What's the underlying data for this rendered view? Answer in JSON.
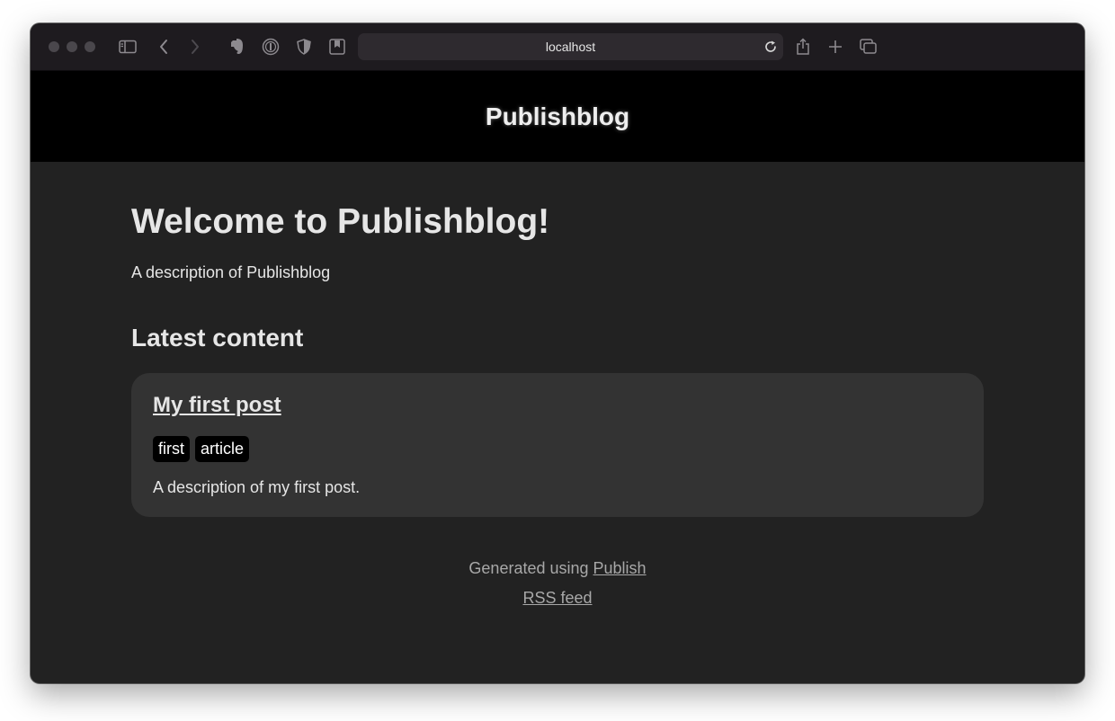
{
  "browser": {
    "address": "localhost",
    "icons": [
      "sidebar-icon",
      "back-icon",
      "forward-icon",
      "evernote-icon",
      "password-manager-icon",
      "privacy-shield-icon",
      "bookmark-icon",
      "reload-icon",
      "share-icon",
      "new-tab-icon",
      "tab-overview-icon"
    ]
  },
  "site": {
    "name": "Publishblog"
  },
  "main": {
    "title": "Welcome to Publishblog!",
    "description": "A description of Publishblog",
    "section_title": "Latest content",
    "posts": [
      {
        "title": "My first post",
        "tags": [
          "first",
          "article"
        ],
        "description": "A description of my first post."
      }
    ]
  },
  "footer": {
    "generated_prefix": "Generated using",
    "generator_link": "Publish",
    "rss_link": "RSS feed"
  },
  "colors": {
    "header_bg": "#000000",
    "page_bg": "#222222",
    "card_bg": "#333333",
    "text": "#e6e6e6",
    "footer_text": "#a8a8a8"
  }
}
